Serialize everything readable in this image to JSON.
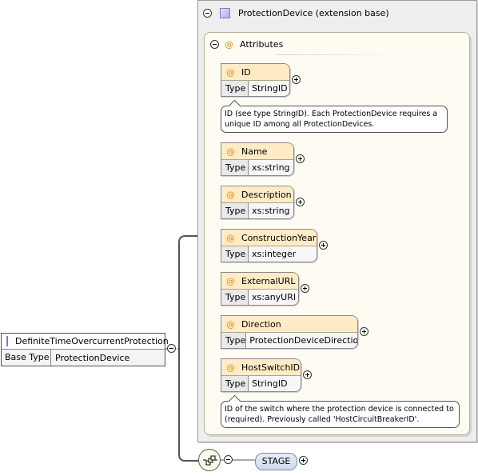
{
  "element": {
    "name": "DefiniteTimeOvercurrentProtection",
    "base_type_label": "Base Type",
    "base_type_value": "ProtectionDevice"
  },
  "extension": {
    "title": "ProtectionDevice (extension base)"
  },
  "attributes_group": {
    "title": "Attributes",
    "icon": "@"
  },
  "attributes": [
    {
      "name": "ID",
      "type_label": "Type",
      "type": "StringID"
    },
    {
      "name": "Name",
      "type_label": "Type",
      "type": "xs:string"
    },
    {
      "name": "Description",
      "type_label": "Type",
      "type": "xs:string"
    },
    {
      "name": "ConstructionYear",
      "type_label": "Type",
      "type": "xs:integer"
    },
    {
      "name": "ExternalURL",
      "type_label": "Type",
      "type": "xs:anyURI"
    },
    {
      "name": "Direction",
      "type_label": "Type",
      "type": "ProtectionDeviceDirection"
    },
    {
      "name": "HostSwitchID",
      "type_label": "Type",
      "type": "StringID"
    }
  ],
  "notes": {
    "id": "ID (see type StringID). Each ProtectionDevice requires a unique ID among all ProtectionDevices.",
    "host_switch": "ID of the switch where the protection device is connected to (required). Previously called 'HostCircuitBreakerID'."
  },
  "sequence": {
    "child": "STAGE"
  },
  "icons": {
    "collapse": "minus-circle-icon",
    "expand": "plus-circle-icon",
    "complex_type": "complex-type-icon",
    "attribute": "attribute-icon",
    "sequence": "sequence-icon"
  },
  "colors": {
    "attribute_header": "#ffecc6",
    "attributes_bg": "#fefbf3",
    "extension_bg": "#eeeeee",
    "stage_fill": "#cfdaee"
  }
}
